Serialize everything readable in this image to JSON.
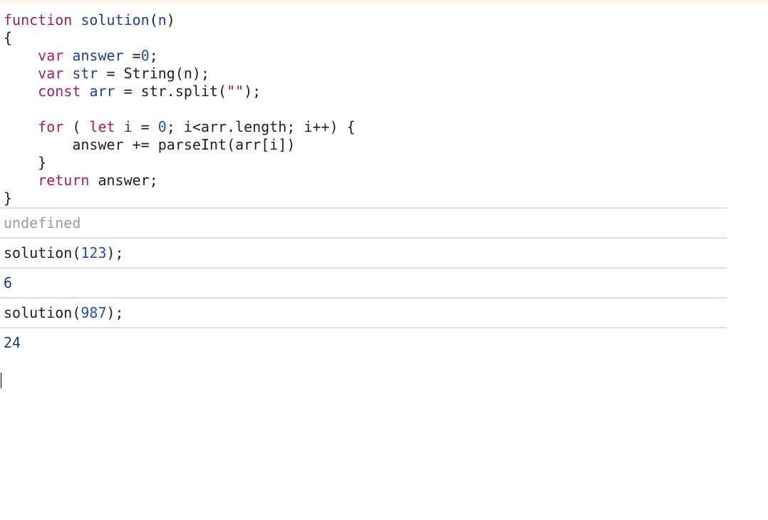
{
  "code": {
    "kw_function": "function",
    "fn_name": "solution",
    "param_open": "(",
    "param_n": "n",
    "param_close": ")",
    "brace_open": "{",
    "line_var_answer_kw": "var",
    "line_var_answer_name": "answer",
    "line_var_answer_eq": " =",
    "line_var_answer_val": "0",
    "line_var_answer_semi": ";",
    "line_var_str_kw": "var",
    "line_var_str_name": "str",
    "line_var_str_rest": " = String(n);",
    "line_const_kw": "const",
    "line_const_name": "arr",
    "line_const_rest_a": " = str.split(",
    "line_const_string": "\"\"",
    "line_const_rest_b": ");",
    "line_for_kw": "for",
    "line_for_paren": " ( ",
    "line_for_let": "let",
    "line_for_i": "i",
    "line_for_eq": " = ",
    "line_for_zero": "0",
    "line_for_rest": "; i<arr.length; i++) {",
    "line_answer_plus": "answer += parseInt(arr[i])",
    "line_inner_close": "}",
    "line_return_kw": "return",
    "line_return_rest": " answer;",
    "brace_close": "}"
  },
  "entries": [
    {
      "type": "output",
      "text": "undefined"
    },
    {
      "type": "input",
      "fn": "solution(",
      "arg": "123",
      "tail": ");"
    },
    {
      "type": "output",
      "text": "6"
    },
    {
      "type": "input",
      "fn": "solution(",
      "arg": "987",
      "tail": ");"
    },
    {
      "type": "output",
      "text": "24"
    }
  ],
  "colors": {
    "keyword": "#b0185e",
    "identifier": "#1a3fa0",
    "number": "#1c4fd0",
    "string": "#a11d1d",
    "undefined": "#9b9b9b",
    "separator": "#d7e2f1"
  }
}
